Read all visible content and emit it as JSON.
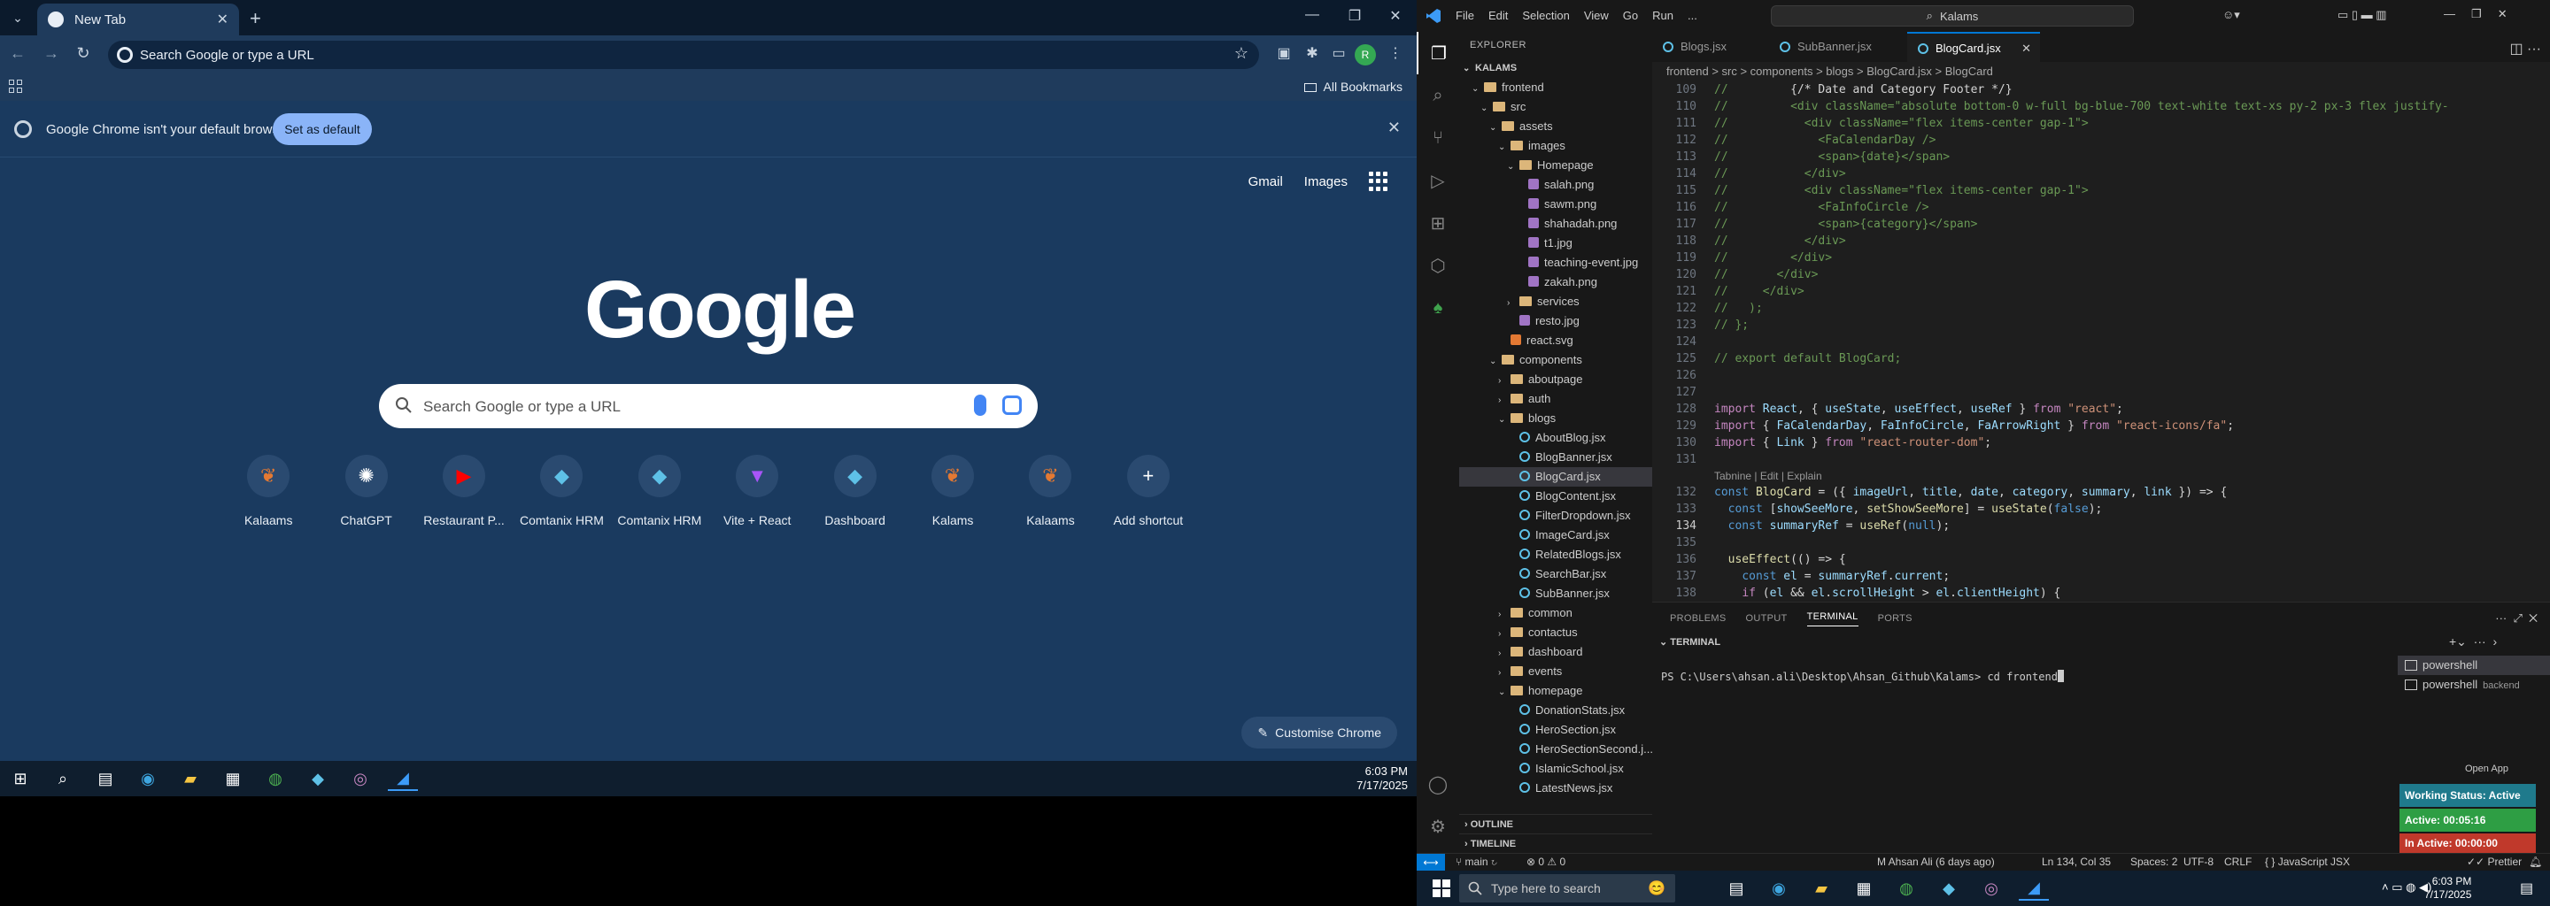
{
  "chrome": {
    "tab_title": "New Tab",
    "omnibox_placeholder": "Search Google or type a URL",
    "all_bookmarks": "All Bookmarks",
    "info_message": "Google Chrome isn't your default browser",
    "set_default": "Set as default",
    "top_links": [
      "Gmail",
      "Images"
    ],
    "logo_text": "Google",
    "search_placeholder": "Search Google or type a URL",
    "shortcuts": [
      {
        "label": "Kalaams",
        "icon": "kalaams-icon"
      },
      {
        "label": "ChatGPT",
        "icon": "chatgpt-icon"
      },
      {
        "label": "Restaurant P...",
        "icon": "youtube-icon"
      },
      {
        "label": "Comtanix HRM",
        "icon": "comtanix-icon"
      },
      {
        "label": "Comtanix HRM",
        "icon": "comtanix-icon"
      },
      {
        "label": "Vite + React",
        "icon": "vite-icon"
      },
      {
        "label": "Dashboard",
        "icon": "dashboard-icon"
      },
      {
        "label": "Kalams",
        "icon": "kalaams-icon"
      },
      {
        "label": "Kalaams",
        "icon": "kalaams-icon"
      },
      {
        "label": "Add shortcut",
        "icon": "plus-icon"
      }
    ],
    "customise": "Customise Chrome",
    "profile_initial": "R"
  },
  "taskbar_left": {
    "time": "6:03 PM",
    "date": "7/17/2025"
  },
  "vscode": {
    "menu": [
      "File",
      "Edit",
      "Selection",
      "View",
      "Go",
      "Run",
      "..."
    ],
    "command_center": "Kalams",
    "explorer_title": "EXPLORER",
    "workspace": "KALAMS",
    "tree": [
      {
        "label": "frontend",
        "type": "folder",
        "depth": 1,
        "open": true
      },
      {
        "label": "src",
        "type": "folder",
        "depth": 2,
        "open": true
      },
      {
        "label": "assets",
        "type": "folder",
        "depth": 3,
        "open": true
      },
      {
        "label": "images",
        "type": "folder",
        "depth": 4,
        "open": true
      },
      {
        "label": "Homepage",
        "type": "folder",
        "depth": 5,
        "open": true
      },
      {
        "label": "salah.png",
        "type": "img",
        "depth": 6
      },
      {
        "label": "sawm.png",
        "type": "img",
        "depth": 6
      },
      {
        "label": "shahadah.png",
        "type": "img",
        "depth": 6
      },
      {
        "label": "t1.jpg",
        "type": "img",
        "depth": 6
      },
      {
        "label": "teaching-event.jpg",
        "type": "img",
        "depth": 6
      },
      {
        "label": "zakah.png",
        "type": "img",
        "depth": 6
      },
      {
        "label": "services",
        "type": "folder",
        "depth": 5,
        "open": false
      },
      {
        "label": "resto.jpg",
        "type": "img",
        "depth": 5
      },
      {
        "label": "react.svg",
        "type": "svg",
        "depth": 4
      },
      {
        "label": "components",
        "type": "folder",
        "depth": 3,
        "open": true
      },
      {
        "label": "aboutpage",
        "type": "folder",
        "depth": 4,
        "open": false
      },
      {
        "label": "auth",
        "type": "folder",
        "depth": 4,
        "open": false
      },
      {
        "label": "blogs",
        "type": "folder",
        "depth": 4,
        "open": true
      },
      {
        "label": "AboutBlog.jsx",
        "type": "jsx",
        "depth": 5
      },
      {
        "label": "BlogBanner.jsx",
        "type": "jsx",
        "depth": 5
      },
      {
        "label": "BlogCard.jsx",
        "type": "jsx",
        "depth": 5,
        "selected": true
      },
      {
        "label": "BlogContent.jsx",
        "type": "jsx",
        "depth": 5
      },
      {
        "label": "FilterDropdown.jsx",
        "type": "jsx",
        "depth": 5
      },
      {
        "label": "ImageCard.jsx",
        "type": "jsx",
        "depth": 5
      },
      {
        "label": "RelatedBlogs.jsx",
        "type": "jsx",
        "depth": 5
      },
      {
        "label": "SearchBar.jsx",
        "type": "jsx",
        "depth": 5
      },
      {
        "label": "SubBanner.jsx",
        "type": "jsx",
        "depth": 5
      },
      {
        "label": "common",
        "type": "folder",
        "depth": 4,
        "open": false
      },
      {
        "label": "contactus",
        "type": "folder",
        "depth": 4,
        "open": false
      },
      {
        "label": "dashboard",
        "type": "folder",
        "depth": 4,
        "open": false
      },
      {
        "label": "events",
        "type": "folder",
        "depth": 4,
        "open": false
      },
      {
        "label": "homepage",
        "type": "folder",
        "depth": 4,
        "open": true
      },
      {
        "label": "DonationStats.jsx",
        "type": "jsx",
        "depth": 5
      },
      {
        "label": "HeroSection.jsx",
        "type": "jsx",
        "depth": 5
      },
      {
        "label": "HeroSectionSecond.j...",
        "type": "jsx",
        "depth": 5
      },
      {
        "label": "IslamicSchool.jsx",
        "type": "jsx",
        "depth": 5
      },
      {
        "label": "LatestNews.jsx",
        "type": "jsx",
        "depth": 5
      }
    ],
    "outline": "OUTLINE",
    "timeline": "TIMELINE",
    "tabs": [
      "Blogs.jsx",
      "SubBanner.jsx",
      "BlogCard.jsx"
    ],
    "breadcrumb": "frontend > src > components > blogs > BlogCard.jsx > BlogCard",
    "panel_tabs": [
      "PROBLEMS",
      "OUTPUT",
      "TERMINAL",
      "PORTS"
    ],
    "terminal_header": "TERMINAL",
    "terminal_prompt": "PS C:\\Users\\ahsan.ali\\Desktop\\Ahsan_Github\\Kalams> cd frontend",
    "terminals": [
      {
        "name": "powershell",
        "sub": ""
      },
      {
        "name": "powershell",
        "sub": "backend"
      }
    ],
    "open_app": "Open App",
    "working_status": "Working Status: Active",
    "active_time": "Active: 00:05:16",
    "inactive_time": "In Active: 00:00:00",
    "status": {
      "branch": "main",
      "problems": "0 ⚠ 0",
      "blame": "M Ahsan Ali (6 days ago)",
      "position": "Ln 134, Col 35",
      "spaces": "Spaces: 2",
      "encoding": "UTF-8",
      "eol": "CRLF",
      "language": "JavaScript JSX",
      "prettier": "Prettier"
    },
    "tabnine_hint": "Tabnine | Edit | Explain"
  },
  "taskbar_right": {
    "search_placeholder": "Type here to search",
    "time": "6:03 PM",
    "date": "7/17/2025"
  },
  "colors": {
    "chrome_bg": "#1a3a5f",
    "vscode_bg": "#1e1e1e",
    "accent": "#0078d4",
    "working_status": "#1f7a8c",
    "active": "#2e9e44",
    "inactive": "#c0392b"
  }
}
